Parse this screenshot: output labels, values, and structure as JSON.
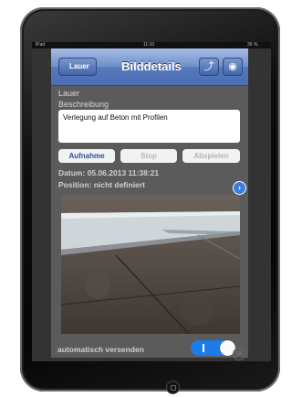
{
  "statusbar": {
    "carrier": "iPad",
    "time": "11:10",
    "battery": "36 %"
  },
  "navbar": {
    "back_label": "Lauer",
    "title": "Bilddetails",
    "share_icon": "share-image-icon",
    "camera_icon": "camera-icon"
  },
  "form": {
    "name": "Lauer",
    "description_label": "Beschreibung",
    "description_value": "Verlegung auf Beton mit Profilen",
    "record_button": "Aufnahme",
    "stop_button": "Stop",
    "play_button": "Abspielen",
    "date_text": "Datum: 05.06.2013 11:38:21",
    "position_text": "Position: nicht definiert"
  },
  "footer": {
    "auto_send_label": "automatisch versenden",
    "auto_send_enabled": true
  },
  "zoom_badge": "1X",
  "colors": {
    "nav_blue": "#5779bd",
    "toggle_on": "#1e7bea",
    "app_bg": "#5b5b5b"
  }
}
